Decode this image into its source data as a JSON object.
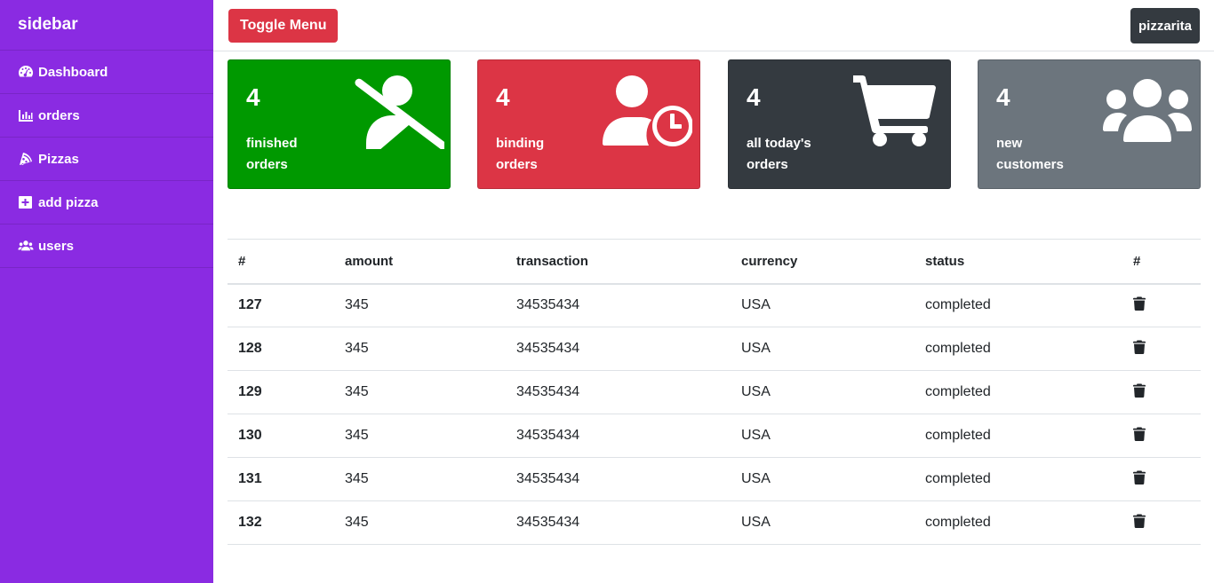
{
  "sidebar": {
    "title": "sidebar",
    "items": [
      {
        "label": "Dashboard",
        "icon": "tachometer-icon"
      },
      {
        "label": "orders",
        "icon": "bar-chart-icon"
      },
      {
        "label": "Pizzas",
        "icon": "pizza-slice-icon"
      },
      {
        "label": "add pizza",
        "icon": "plus-square-icon"
      },
      {
        "label": "users",
        "icon": "users-icon"
      }
    ]
  },
  "topbar": {
    "toggle_label": "Toggle Menu",
    "user_label": "pizzarita"
  },
  "cards": [
    {
      "count": "4",
      "label_line1": "finished",
      "label_line2": "orders",
      "color": "#009900",
      "icon": "user-slash-icon"
    },
    {
      "count": "4",
      "label_line1": "binding",
      "label_line2": "orders",
      "color": "#dc3545",
      "icon": "user-clock-icon"
    },
    {
      "count": "4",
      "label_line1": "all today's",
      "label_line2": "orders",
      "color": "#343a40",
      "icon": "shopping-cart-icon"
    },
    {
      "count": "4",
      "label_line1": "new",
      "label_line2": "customers",
      "color": "#6c757d",
      "icon": "users-icon"
    }
  ],
  "table": {
    "headers": [
      "#",
      "amount",
      "transaction",
      "currency",
      "status",
      "#"
    ],
    "rows": [
      {
        "id": "127",
        "amount": "345",
        "transaction": "34535434",
        "currency": "USA",
        "status": "completed"
      },
      {
        "id": "128",
        "amount": "345",
        "transaction": "34535434",
        "currency": "USA",
        "status": "completed"
      },
      {
        "id": "129",
        "amount": "345",
        "transaction": "34535434",
        "currency": "USA",
        "status": "completed"
      },
      {
        "id": "130",
        "amount": "345",
        "transaction": "34535434",
        "currency": "USA",
        "status": "completed"
      },
      {
        "id": "131",
        "amount": "345",
        "transaction": "34535434",
        "currency": "USA",
        "status": "completed"
      },
      {
        "id": "132",
        "amount": "345",
        "transaction": "34535434",
        "currency": "USA",
        "status": "completed"
      }
    ]
  },
  "colors": {
    "sidebar_bg": "#8a2be2",
    "finished": "#009900",
    "binding": "#dc3545",
    "today": "#343a40",
    "customers": "#6c757d"
  }
}
